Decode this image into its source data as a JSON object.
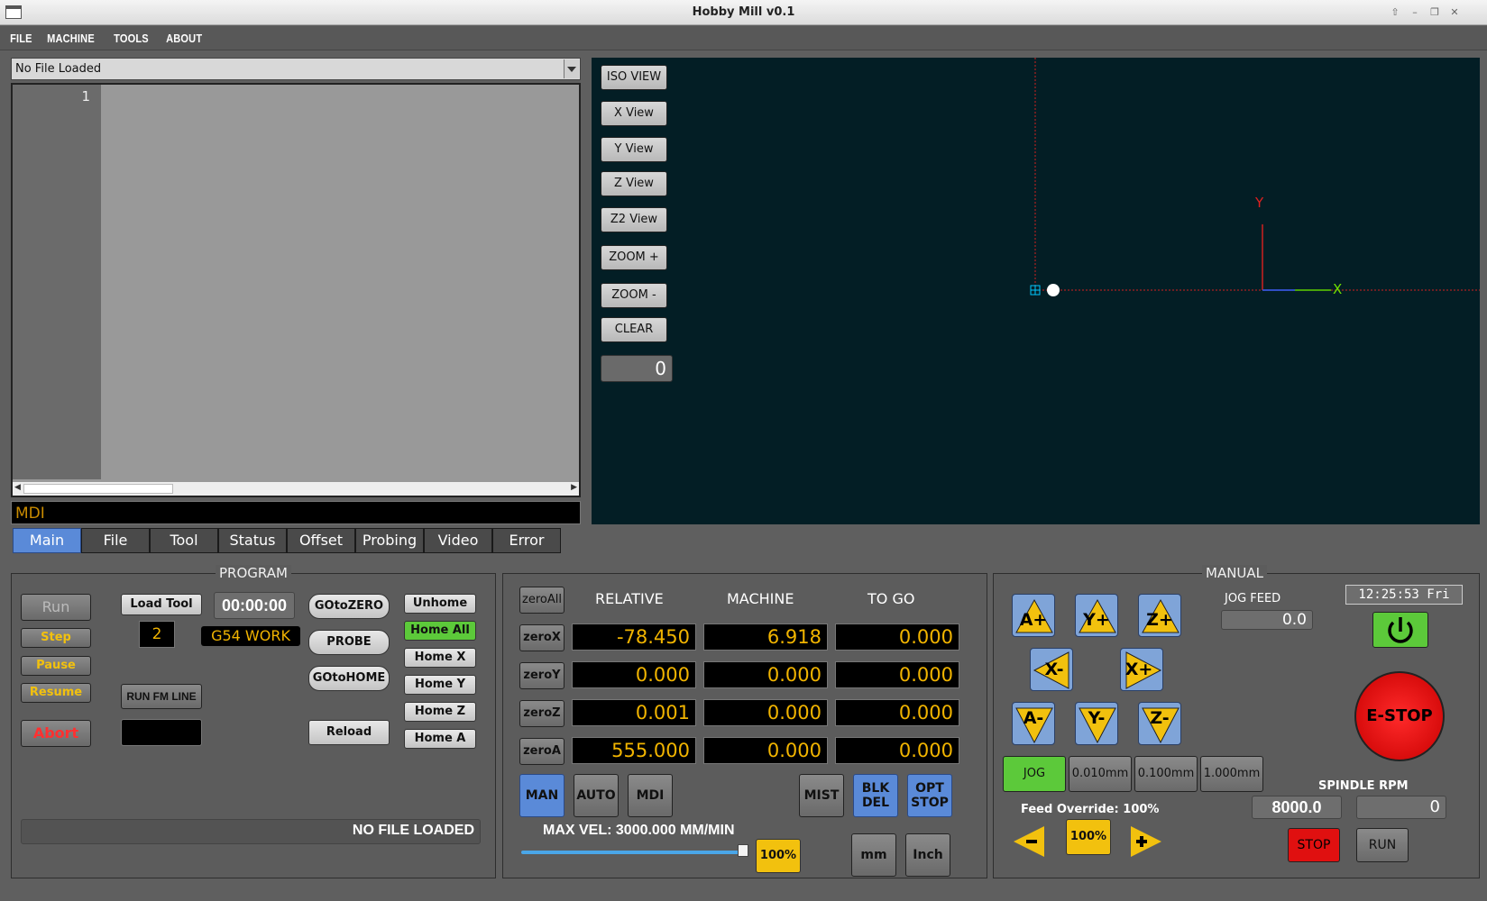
{
  "window": {
    "title": "Hobby Mill v0.1"
  },
  "menu": [
    "FILE",
    "MACHINE",
    "TOOLS",
    "ABOUT"
  ],
  "file_combo": {
    "value": "No File Loaded"
  },
  "editor": {
    "line_number": "1"
  },
  "mdi": {
    "label": "MDI"
  },
  "tabs": [
    "Main",
    "File",
    "Tool",
    "Status",
    "Offset",
    "Probing",
    "Video",
    "Error"
  ],
  "view_buttons": [
    "ISO VIEW",
    "X View",
    "Y View",
    "Z View",
    "Z2 View",
    "ZOOM +",
    "ZOOM -",
    "CLEAR"
  ],
  "view_value": "0",
  "axis_labels": {
    "x": "X",
    "y": "Y"
  },
  "program": {
    "title": "PROGRAM",
    "run": "Run",
    "step": "Step",
    "pause": "Pause",
    "resume": "Resume",
    "abort": "Abort",
    "load_tool": "Load Tool",
    "tool_number": "2",
    "timer": "00:00:00",
    "work_offset": "G54 WORK",
    "run_from_line": "RUN FM LINE",
    "goto_zero": "GOtoZERO",
    "probe": "PROBE",
    "goto_home": "GOtoHOME",
    "reload": "Reload",
    "unhome": "Unhome",
    "home_all": "Home All",
    "home_x": "Home X",
    "home_y": "Home Y",
    "home_z": "Home Z",
    "home_a": "Home A",
    "status": "NO FILE LOADED"
  },
  "dro": {
    "headers": [
      "RELATIVE",
      "MACHINE",
      "TO GO"
    ],
    "zero_all": "zeroAll",
    "rows": [
      {
        "zero": "zeroX",
        "relative": "-78.450",
        "machine": "6.918",
        "togo": "0.000"
      },
      {
        "zero": "zeroY",
        "relative": "0.000",
        "machine": "0.000",
        "togo": "0.000"
      },
      {
        "zero": "zeroZ",
        "relative": "0.001",
        "machine": "0.000",
        "togo": "0.000"
      },
      {
        "zero": "zeroA",
        "relative": "555.000",
        "machine": "0.000",
        "togo": "0.000"
      }
    ],
    "mode_man": "MAN",
    "mode_auto": "AUTO",
    "mode_mdi": "MDI",
    "mist": "MIST",
    "blk_del_1": "BLK",
    "blk_del_2": "DEL",
    "opt_stop_1": "OPT",
    "opt_stop_2": "STOP",
    "max_vel": "MAX VEL: 3000.000 MM/MIN",
    "max_vel_pct": "100%",
    "max_vel_slider": 1.0,
    "mm": "mm",
    "inch": "Inch"
  },
  "manual": {
    "title": "MANUAL",
    "jog_feed_label": "JOG FEED",
    "jog_feed": "0.0",
    "clock": "12:25:53 Fri",
    "jog_buttons": {
      "a_plus": "A+",
      "y_plus": "Y+",
      "z_plus": "Z+",
      "x_minus": "X-",
      "x_plus": "X+",
      "a_minus": "A-",
      "y_minus": "Y-",
      "z_minus": "Z-"
    },
    "estop": "E-STOP",
    "jog": "JOG",
    "inc1": "0.010mm",
    "inc2": "0.100mm",
    "inc3": "1.000mm",
    "feed_override": "Feed Override: 100%",
    "feed_pct": "100%",
    "spindle_label": "SPINDLE RPM",
    "spindle_set": "8000.0",
    "spindle_actual": "0",
    "stop": "STOP",
    "run": "RUN"
  },
  "colors": {
    "accent_blue": "#5a8ad8",
    "dro_text": "#f1b400",
    "estop": "#e01010",
    "green": "#5cc93a",
    "yellow": "#f2c10e"
  }
}
